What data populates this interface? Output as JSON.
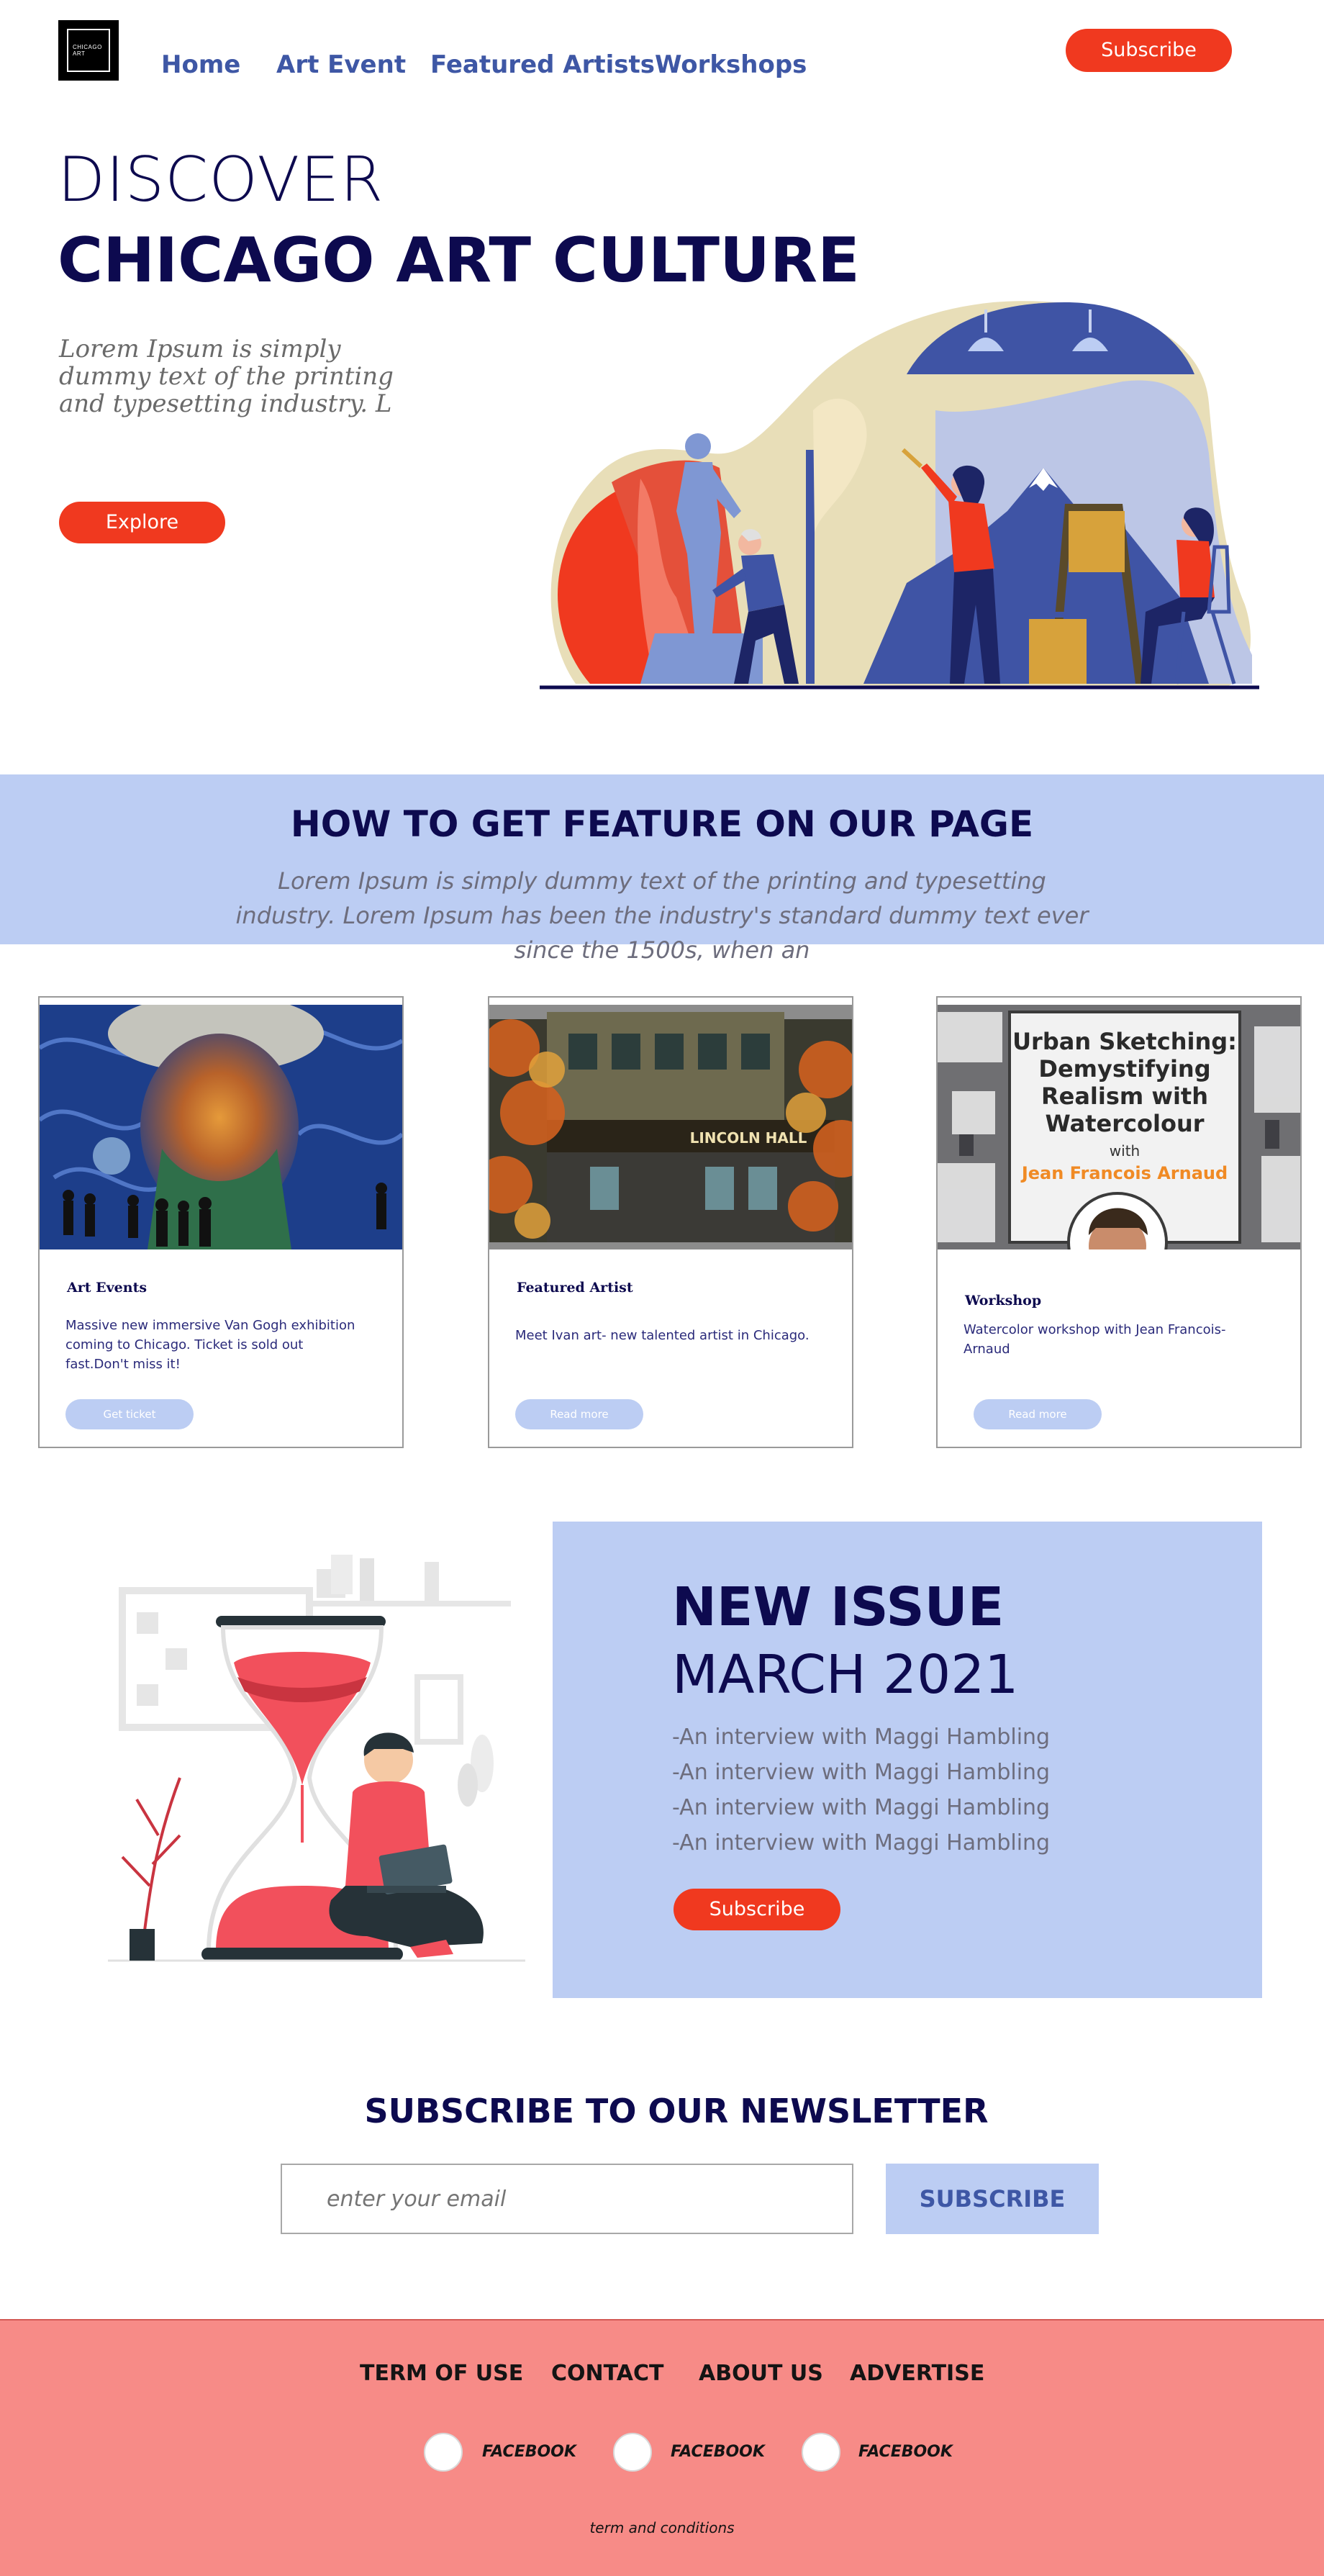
{
  "header": {
    "logo_line1": "CHICAGO",
    "logo_line2": "ART",
    "nav": [
      "Home",
      "Art Event",
      "Featured Artists",
      "Workshops"
    ],
    "subscribe_label": "Subscribe"
  },
  "hero": {
    "title_line1": "DISCOVER",
    "title_line2": "CHICAGO ART CULTURE",
    "text": "Lorem Ipsum is simply dummy text of the printing and typesetting industry. L",
    "explore_label": "Explore"
  },
  "feature": {
    "title": "HOW TO GET FEATURE ON OUR PAGE",
    "text": "Lorem Ipsum is simply dummy text of the printing and typesetting industry. Lorem Ipsum has been the industry's standard dummy text ever since the 1500s, when an"
  },
  "cards": [
    {
      "title": "Art Events",
      "text": "Massive new immersive Van Gogh exhibition coming to Chicago. Ticket is sold out fast.Don't miss it!",
      "button": "Get ticket"
    },
    {
      "title": "Featured Artist",
      "text": "Meet Ivan art- new talented artist in Chicago.",
      "button": "Read more",
      "image_sign": "LINCOLN HALL"
    },
    {
      "title": "Workshop",
      "text": "Watercolor workshop with Jean Francois-Arnaud",
      "button": "Read more",
      "image_title_1": "Urban Sketching:",
      "image_title_2": "Demystifying",
      "image_title_3": "Realism with",
      "image_title_4": "Watercolour",
      "image_with": "with",
      "image_author": "Jean Francois Arnaud"
    }
  ],
  "issue": {
    "title": "NEW ISSUE",
    "date": "MARCH 2021",
    "items": [
      "-An interview with Maggi Hambling",
      "-An interview with Maggi Hambling",
      "-An interview with Maggi Hambling",
      "-An interview with Maggi Hambling"
    ],
    "subscribe_label": "Subscribe"
  },
  "newsletter": {
    "title": "SUBSCRIBE TO OUR NEWSLETTER",
    "placeholder": "enter your email",
    "button": "SUBSCRIBE"
  },
  "footer": {
    "links": [
      "TERM OF USE",
      "CONTACT",
      "ABOUT US",
      "ADVERTISE"
    ],
    "social": [
      "FACEBOOK",
      "FACEBOOK",
      "FACEBOOK"
    ],
    "terms": "term and conditions"
  },
  "colors": {
    "accent": "#f0391f",
    "navy": "#0d0a4f",
    "link": "#3e57a5",
    "light_blue": "#bccdf3",
    "footer": "#f78b87"
  }
}
